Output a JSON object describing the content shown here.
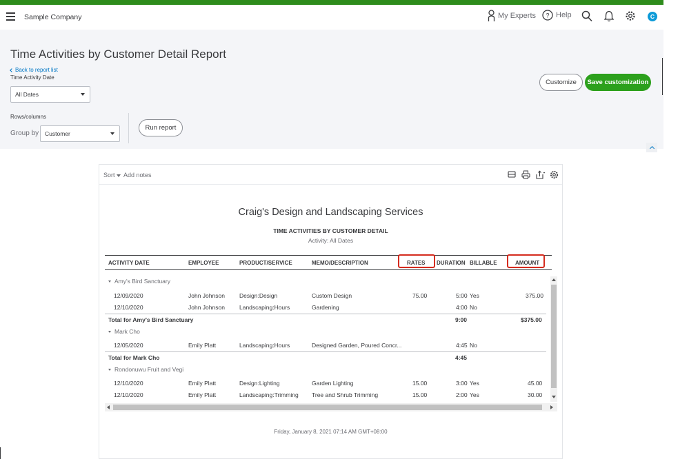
{
  "topbar": {
    "company": "Sample Company",
    "my_experts": "My Experts",
    "help": "Help",
    "avatar_letter": "C"
  },
  "page": {
    "title": "Time Activities by Customer Detail Report",
    "back_link": "Back to report list",
    "time_activity_date_label": "Time Activity Date",
    "date_select_value": "All Dates",
    "rows_columns_label": "Rows/columns",
    "group_by_label": "Group by",
    "group_by_value": "Customer",
    "run_report": "Run report",
    "customize": "Customize",
    "save_customization": "Save customization"
  },
  "report": {
    "sort": "Sort",
    "add_notes": "Add notes",
    "company_name": "Craig's Design and Landscaping Services",
    "title": "TIME ACTIVITIES BY CUSTOMER DETAIL",
    "subtitle": "Activity: All Dates",
    "columns": [
      "ACTIVITY DATE",
      "EMPLOYEE",
      "PRODUCT/SERVICE",
      "MEMO/DESCRIPTION",
      "RATES",
      "DURATION",
      "BILLABLE",
      "AMOUNT"
    ],
    "groups": [
      {
        "name": "Amy's Bird Sanctuary",
        "rows": [
          {
            "date": "12/09/2020",
            "employee": "John Johnson",
            "product": "Design:Design",
            "memo": "Custom Design",
            "rate": "75.00",
            "duration": "5:00",
            "billable": "Yes",
            "amount": "375.00"
          },
          {
            "date": "12/10/2020",
            "employee": "John Johnson",
            "product": "Landscaping:Hours",
            "memo": "Gardening",
            "rate": "",
            "duration": "4:00",
            "billable": "No",
            "amount": ""
          }
        ],
        "total_label": "Total for Amy's Bird Sanctuary",
        "total_duration": "9:00",
        "total_amount": "$375.00"
      },
      {
        "name": "Mark Cho",
        "rows": [
          {
            "date": "12/05/2020",
            "employee": "Emily Platt",
            "product": "Landscaping:Hours",
            "memo": "Designed Garden, Poured Concr...",
            "rate": "",
            "duration": "4:45",
            "billable": "No",
            "amount": ""
          }
        ],
        "total_label": "Total for Mark Cho",
        "total_duration": "4:45",
        "total_amount": ""
      },
      {
        "name": "Rondonuwu Fruit and Vegi",
        "rows": [
          {
            "date": "12/10/2020",
            "employee": "Emily Platt",
            "product": "Design:Lighting",
            "memo": "Garden Lighting",
            "rate": "15.00",
            "duration": "3:00",
            "billable": "Yes",
            "amount": "45.00"
          },
          {
            "date": "12/10/2020",
            "employee": "Emily Platt",
            "product": "Landscaping:Trimming",
            "memo": "Tree and Shrub Trimming",
            "rate": "15.00",
            "duration": "2:00",
            "billable": "Yes",
            "amount": "30.00"
          }
        ]
      }
    ],
    "footer_timestamp": "Friday, January 8, 2021   07:14 AM GMT+08:00"
  },
  "colors": {
    "brand_green": "#2ca01c",
    "top_strip": "#2e8c1c",
    "link_blue": "#0077c5",
    "highlight_red": "#d52b1e"
  }
}
